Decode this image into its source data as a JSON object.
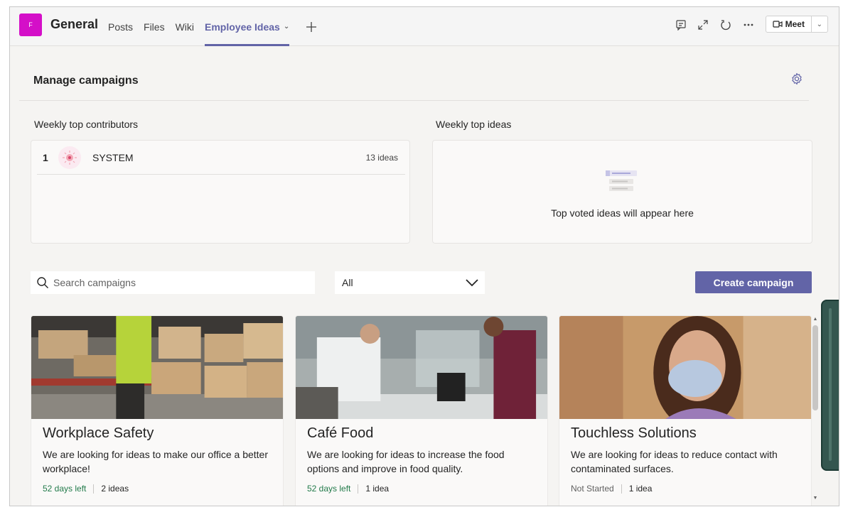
{
  "header": {
    "team_initial": "F",
    "channel_name": "General",
    "tabs": [
      {
        "label": "Posts",
        "active": false
      },
      {
        "label": "Files",
        "active": false
      },
      {
        "label": "Wiki",
        "active": false
      },
      {
        "label": "Employee Ideas",
        "active": true
      }
    ],
    "meet_label": "Meet",
    "icons": [
      "chat-icon",
      "expand-icon",
      "refresh-icon",
      "more-icon"
    ]
  },
  "page": {
    "title": "Manage campaigns"
  },
  "contributors": {
    "label": "Weekly top contributors",
    "rows": [
      {
        "rank": "1",
        "name": "SYSTEM",
        "count": "13 ideas"
      }
    ]
  },
  "top_ideas": {
    "label": "Weekly top ideas",
    "empty_text": "Top voted ideas will appear here"
  },
  "toolbar": {
    "search_placeholder": "Search campaigns",
    "filter_value": "All",
    "create_label": "Create campaign"
  },
  "campaigns": [
    {
      "title": "Workplace Safety",
      "description": "We are looking for ideas to make our office a better workplace!",
      "status": "52 days left",
      "status_color": "#237b4b",
      "count": "2 ideas"
    },
    {
      "title": "Café Food",
      "description": "We are looking for ideas to increase the food options and improve in food quality.",
      "status": "52 days left",
      "status_color": "#237b4b",
      "count": "1 idea"
    },
    {
      "title": "Touchless Solutions",
      "description": "We are looking for ideas to reduce contact with contaminated surfaces.",
      "status": "Not Started",
      "status_color": "#616161",
      "count": "1 idea"
    }
  ],
  "colors": {
    "accent": "#6264a7",
    "team_avatar": "#d40fc8"
  }
}
